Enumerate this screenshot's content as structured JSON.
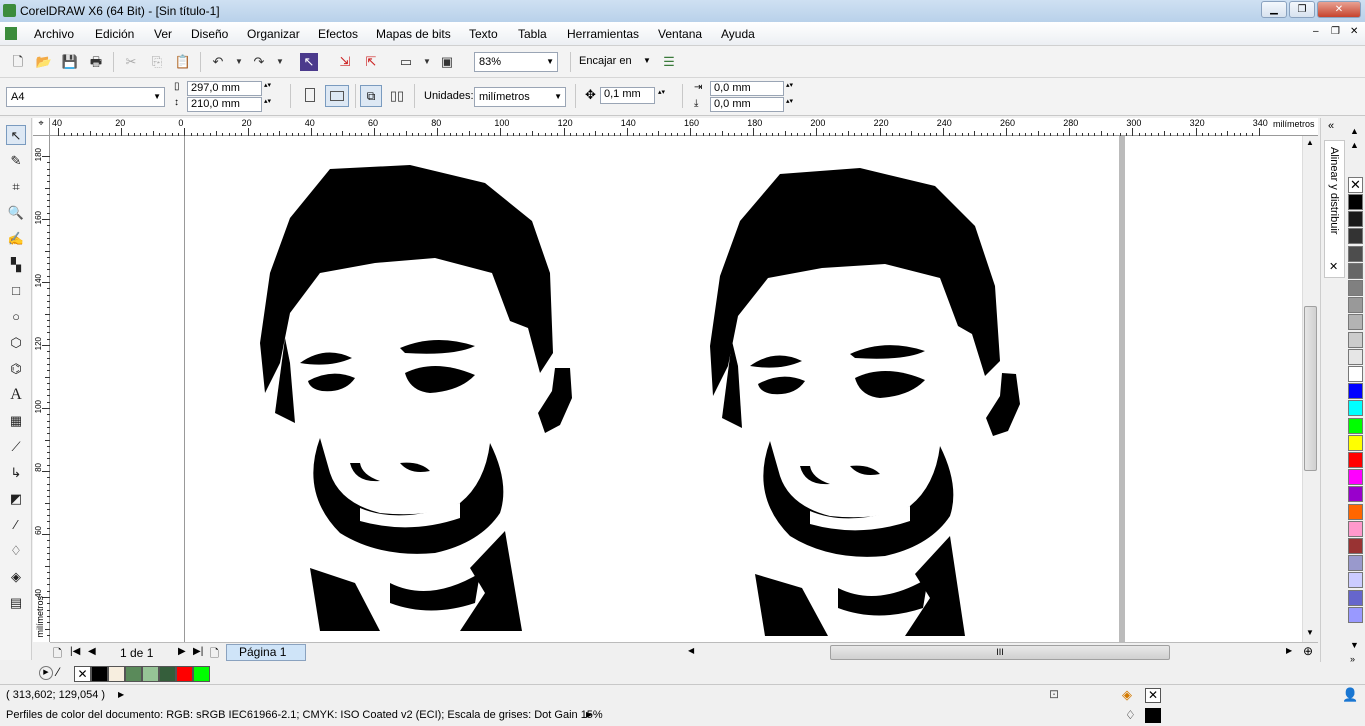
{
  "window": {
    "title": "CorelDRAW X6 (64 Bit) - [Sin título-1]",
    "minimize": "▁",
    "maximize": "❐",
    "close": "✕"
  },
  "menu": [
    "Archivo",
    "Edición",
    "Ver",
    "Diseño",
    "Organizar",
    "Efectos",
    "Mapas de bits",
    "Texto",
    "Tabla",
    "Herramientas",
    "Ventana",
    "Ayuda"
  ],
  "toolbar": {
    "zoom": "83%",
    "snap": "Encajar en"
  },
  "propertybar": {
    "page_size": "A4",
    "width": "297,0 mm",
    "height": "210,0 mm",
    "units_label": "Unidades:",
    "units": "milímetros",
    "nudge": "0,1 mm",
    "dup_x": "0,0 mm",
    "dup_y": "0,0 mm"
  },
  "ruler": {
    "h_ticks": [
      "40",
      "20",
      "0",
      "20",
      "40",
      "60",
      "80",
      "100",
      "120",
      "140",
      "160",
      "180",
      "200",
      "220",
      "240",
      "260",
      "280",
      "300",
      "320",
      "340"
    ],
    "h_unit": "milímetros",
    "v_ticks": [
      "180",
      "160",
      "140",
      "120",
      "100",
      "80",
      "60",
      "40"
    ],
    "v_unit": "milímetros"
  },
  "pagebar": {
    "page_count": "1 de 1",
    "page_tab": "Página 1"
  },
  "docker": {
    "title": "Alinear y distribuir"
  },
  "palette_colors": [
    "#000000",
    "#1a1a1a",
    "#333333",
    "#4d4d4d",
    "#666666",
    "#808080",
    "#999999",
    "#b3b3b3",
    "#cccccc",
    "#e6e6e6",
    "#ffffff",
    "#0000ff",
    "#00ffff",
    "#00ff00",
    "#ffff00",
    "#ff0000",
    "#ff00ff",
    "#9900cc",
    "#ff6600",
    "#ff99cc",
    "#993333",
    "#9999cc",
    "#ccccff",
    "#6666cc",
    "#9999ff"
  ],
  "doc_palette": [
    "#000000",
    "#f7eedf",
    "#5a8a5a",
    "#96c496",
    "#355e3b",
    "#ff0000",
    "#00ff00"
  ],
  "status": {
    "coords": "( 313,602; 129,054 )",
    "profile": "Perfiles de color del documento: RGB: sRGB IEC61966-2.1; CMYK: ISO Coated v2 (ECI); Escala de grises: Dot Gain 15%"
  }
}
